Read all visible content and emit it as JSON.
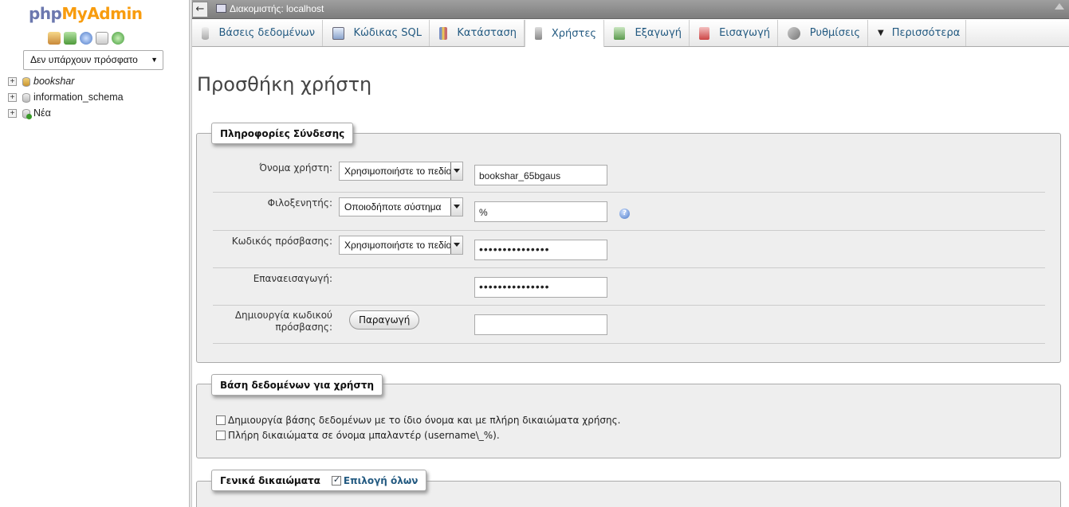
{
  "nav": {
    "logo_a": "php",
    "logo_b": "MyAdmin",
    "recent_label": "Δεν υπάρχουν πρόσφατο",
    "tree": [
      {
        "label": "bookshar",
        "italic": true
      },
      {
        "label": "information_schema",
        "italic": false
      },
      {
        "label": "Νέα",
        "italic": false
      }
    ]
  },
  "topbar": {
    "server_label": "Διακομιστής: localhost"
  },
  "tabs": [
    {
      "label": "Βάσεις δεδομένων",
      "icon": "databases-icon"
    },
    {
      "label": "Κώδικας SQL",
      "icon": "sql-icon"
    },
    {
      "label": "Κατάσταση",
      "icon": "status-icon"
    },
    {
      "label": "Χρήστες",
      "icon": "users-icon",
      "active": true
    },
    {
      "label": "Εξαγωγή",
      "icon": "export-icon"
    },
    {
      "label": "Εισαγωγή",
      "icon": "import-icon"
    },
    {
      "label": "Ρυθμίσεις",
      "icon": "settings-icon"
    },
    {
      "label": "Περισσότερα",
      "icon": "more-icon"
    }
  ],
  "page_title": "Προσθήκη χρήστη",
  "login": {
    "legend": "Πληροφορίες Σύνδεσης",
    "username_label": "Όνομα χρήστη:",
    "username_select": "Χρησιμοποιήστε το πεδίο",
    "username_value": "bookshar_65bgaus",
    "host_label": "Φιλοξενητής:",
    "host_select": "Οποιοδήποτε σύστημα",
    "host_value": "%",
    "password_label": "Κωδικός πρόσβασης:",
    "password_select": "Χρησιμοποιήστε το πεδίο",
    "password_value": "•••••••••••••••",
    "retype_label": "Επαναεισαγωγή:",
    "retype_value": "•••••••••••••••",
    "generate_label_1": "Δημιουργία κωδικού",
    "generate_label_2": "πρόσβασης:",
    "generate_button": "Παραγωγή",
    "generate_value": ""
  },
  "userdb": {
    "legend": "Βάση δεδομένων για χρήστη",
    "option1": "Δημιουργία βάσης δεδομένων με το ίδιο όνομα και με πλήρη δικαιώματα χρήσης.",
    "option2": "Πλήρη δικαιώματα σε όνομα μπαλαντέρ (username\\_%)."
  },
  "global": {
    "legend": "Γενικά δικαιώματα",
    "select_all": "Επιλογή όλων"
  },
  "colors": {
    "accent_link": "#235a81",
    "logo_php": "#6c78af",
    "logo_myadmin": "#f89c0e"
  }
}
